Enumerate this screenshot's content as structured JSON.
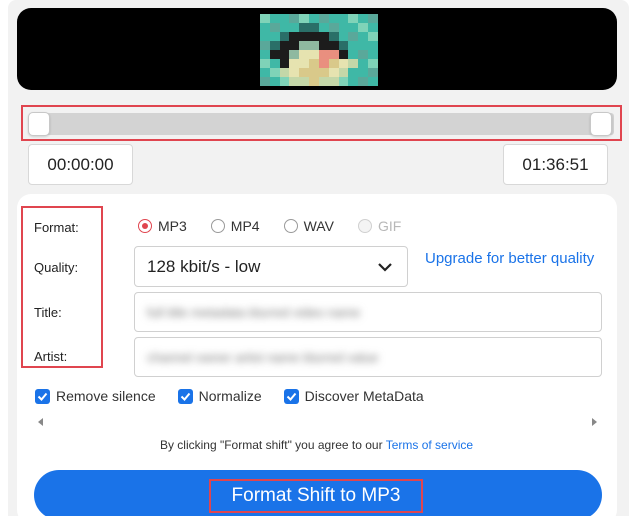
{
  "player": {
    "start_time": "00:00:00",
    "end_time": "01:36:51"
  },
  "form": {
    "format_label": "Format:",
    "quality_label": "Quality:",
    "title_label": "Title:",
    "artist_label": "Artist:",
    "formats": [
      {
        "label": "MP3",
        "selected": true
      },
      {
        "label": "MP4",
        "selected": false
      },
      {
        "label": "WAV",
        "selected": false
      },
      {
        "label": "GIF",
        "selected": false,
        "disabled": true
      }
    ],
    "quality_value": "128 kbit/s - low",
    "upgrade_link": "Upgrade for better quality",
    "title_value": "full title metadata blurred video name",
    "artist_value": "channel owner artist name blurred value"
  },
  "options": {
    "remove_silence": "Remove silence",
    "normalize": "Normalize",
    "discover_metadata": "Discover MetaData"
  },
  "terms": {
    "text": "By clicking \"Format shift\" you agree to our ",
    "link": "Terms of service"
  },
  "cta": {
    "label": "Format Shift to MP3"
  },
  "colors": {
    "accent": "#1a73e8",
    "highlight": "#e0454f",
    "radio_selected": "#e0454f"
  }
}
